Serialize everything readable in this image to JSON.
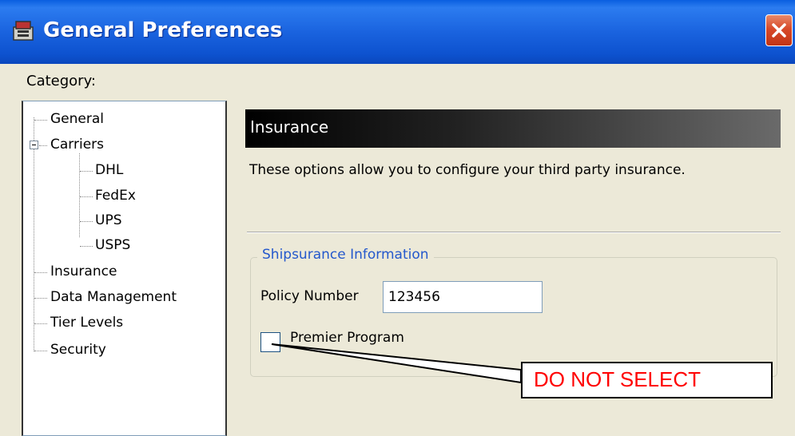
{
  "window": {
    "title": "General Preferences",
    "close_icon": "close-icon",
    "app_icon": "app-icon"
  },
  "category": {
    "label": "Category:",
    "items": [
      {
        "label": "General"
      },
      {
        "label": "Carriers",
        "expanded": true
      },
      {
        "label": "DHL"
      },
      {
        "label": "FedEx"
      },
      {
        "label": "UPS"
      },
      {
        "label": "USPS"
      },
      {
        "label": "Insurance"
      },
      {
        "label": "Data Management"
      },
      {
        "label": "Tier Levels"
      },
      {
        "label": "Security"
      }
    ]
  },
  "panel": {
    "title": "Insurance",
    "description": "These options allow you to configure your third party insurance.",
    "group": {
      "legend": "Shipsurance Information",
      "policy_label": "Policy Number",
      "policy_value": "123456",
      "premier_label": "Premier Program",
      "premier_checked": false
    }
  },
  "callout": {
    "text": "DO NOT SELECT",
    "color": "#ff0000"
  }
}
